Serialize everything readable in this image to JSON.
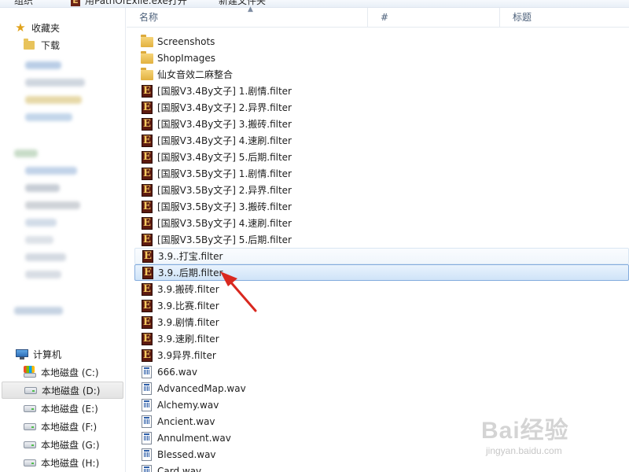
{
  "toolbar": {
    "left_label": "组织",
    "open_label": "用PathOfExile.exe打开",
    "new_folder_label": "新建文件夹"
  },
  "sidebar": {
    "favorites_label": "收藏夹",
    "downloads_label": "下载",
    "computer_label": "计算机",
    "drives": [
      {
        "label": "本地磁盘 (C:)"
      },
      {
        "label": "本地磁盘 (D:)"
      },
      {
        "label": "本地磁盘 (E:)"
      },
      {
        "label": "本地磁盘 (F:)"
      },
      {
        "label": "本地磁盘 (G:)"
      },
      {
        "label": "本地磁盘 (H:)"
      }
    ]
  },
  "columns": {
    "name": "名称",
    "number": "#",
    "title": "标题"
  },
  "files": [
    {
      "name": "Screenshots",
      "type": "folder"
    },
    {
      "name": "ShopImages",
      "type": "folder"
    },
    {
      "name": "仙女音效二麻整合",
      "type": "folder"
    },
    {
      "name": "[国服V3.4By文子] 1.剧情.filter",
      "type": "filter"
    },
    {
      "name": "[国服V3.4By文子] 2.异界.filter",
      "type": "filter"
    },
    {
      "name": "[国服V3.4By文子] 3.搬砖.filter",
      "type": "filter"
    },
    {
      "name": "[国服V3.4By文子] 4.速刷.filter",
      "type": "filter"
    },
    {
      "name": "[国服V3.4By文子] 5.后期.filter",
      "type": "filter"
    },
    {
      "name": "[国服V3.5By文子] 1.剧情.filter",
      "type": "filter"
    },
    {
      "name": "[国服V3.5By文子] 2.异界.filter",
      "type": "filter"
    },
    {
      "name": "[国服V3.5By文子] 3.搬砖.filter",
      "type": "filter"
    },
    {
      "name": "[国服V3.5By文子] 4.速刷.filter",
      "type": "filter"
    },
    {
      "name": "[国服V3.5By文子] 5.后期.filter",
      "type": "filter"
    },
    {
      "name": "3.9..打宝.filter",
      "type": "filter",
      "state": "hover"
    },
    {
      "name": "3.9..后期.filter",
      "type": "filter",
      "state": "selected"
    },
    {
      "name": "3.9.搬砖.filter",
      "type": "filter"
    },
    {
      "name": "3.9.比赛.filter",
      "type": "filter"
    },
    {
      "name": "3.9.剧情.filter",
      "type": "filter"
    },
    {
      "name": "3.9.速刷.filter",
      "type": "filter"
    },
    {
      "name": "3.9异界.filter",
      "type": "filter"
    },
    {
      "name": "666.wav",
      "type": "wav"
    },
    {
      "name": "AdvancedMap.wav",
      "type": "wav"
    },
    {
      "name": "Alchemy.wav",
      "type": "wav"
    },
    {
      "name": "Ancient.wav",
      "type": "wav"
    },
    {
      "name": "Annulment.wav",
      "type": "wav"
    },
    {
      "name": "Blessed.wav",
      "type": "wav"
    },
    {
      "name": "Card.wav",
      "type": "wav"
    }
  ],
  "icons": {
    "folder": "folder-icon",
    "filter": "poe-filter-icon",
    "wav": "wav-file-icon"
  },
  "annotation": {
    "color": "#d9281f"
  },
  "watermark": {
    "text": "Bai经验",
    "sub": "jingyan.baidu.com"
  }
}
